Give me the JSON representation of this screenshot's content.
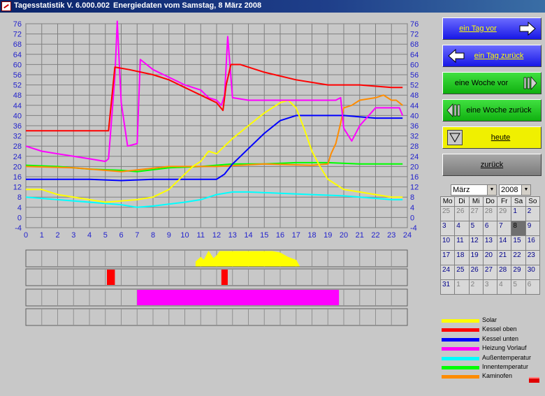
{
  "window": {
    "app_title": "Tagesstatistik V. 6.000.002",
    "date_title": "Energiedaten vom Samstag, 8 März 2008"
  },
  "buttons": {
    "next_day": "ein Tag vor",
    "prev_day": "ein Tag zurück",
    "next_week": "eine Woche vor",
    "prev_week": "eine Woche zurück",
    "today": "heute",
    "back": "zurück"
  },
  "calendar": {
    "month": "März",
    "year": "2008",
    "weekdays": [
      "Mo",
      "Di",
      "Mi",
      "Do",
      "Fr",
      "Sa",
      "So"
    ],
    "weeks": [
      [
        "25",
        "26",
        "27",
        "28",
        "29",
        "1",
        "2"
      ],
      [
        "3",
        "4",
        "5",
        "6",
        "7",
        "8",
        "9"
      ],
      [
        "10",
        "11",
        "12",
        "13",
        "14",
        "15",
        "16"
      ],
      [
        "17",
        "18",
        "19",
        "20",
        "21",
        "22",
        "23"
      ],
      [
        "24",
        "25",
        "26",
        "27",
        "28",
        "29",
        "30"
      ],
      [
        "31",
        "1",
        "2",
        "3",
        "4",
        "5",
        "6"
      ]
    ],
    "selected": "8"
  },
  "legend": [
    {
      "name": "Solar",
      "color": "#ffff00"
    },
    {
      "name": "Kessel oben",
      "color": "#ff0000"
    },
    {
      "name": "Kessel unten",
      "color": "#0000ff"
    },
    {
      "name": "Heizung Vorlauf",
      "color": "#ff00ff"
    },
    {
      "name": "Außentemperatur",
      "color": "#00ffff"
    },
    {
      "name": "Innentemperatur",
      "color": "#00ff00"
    },
    {
      "name": "Kaminofen",
      "color": "#ff8c00"
    }
  ],
  "chart_data": [
    {
      "type": "line",
      "x_ticks": [
        0,
        1,
        2,
        3,
        4,
        5,
        6,
        7,
        8,
        9,
        10,
        11,
        12,
        13,
        14,
        15,
        16,
        17,
        18,
        19,
        20,
        21,
        22,
        23,
        24
      ],
      "y_ticks": [
        -4,
        0,
        4,
        8,
        12,
        16,
        20,
        24,
        28,
        32,
        36,
        40,
        44,
        48,
        52,
        56,
        60,
        64,
        68,
        72,
        76
      ],
      "xlim": [
        0,
        24
      ],
      "ylim": [
        -4,
        76
      ],
      "grid": true,
      "series": [
        {
          "name": "Kessel oben",
          "color": "#ff0000",
          "x": [
            0,
            5.2,
            5.25,
            5.6,
            6.5,
            8,
            9,
            10,
            11,
            12,
            12.4,
            12.6,
            12.9,
            13.5,
            15,
            17,
            19,
            21,
            23,
            23.7
          ],
          "y": [
            34,
            34,
            37,
            59,
            58,
            56,
            54,
            51,
            48,
            45,
            42,
            52,
            60,
            60,
            57,
            54,
            52,
            52,
            51,
            51
          ]
        },
        {
          "name": "Kessel unten",
          "color": "#0000ff",
          "x": [
            0,
            2,
            4,
            6,
            8,
            10,
            11,
            12,
            12.5,
            13,
            14,
            15,
            16,
            17,
            18,
            20,
            22,
            23.7
          ],
          "y": [
            15,
            15,
            15,
            14.5,
            15,
            15,
            15,
            15,
            17,
            21,
            27,
            33,
            38,
            40,
            40,
            40,
            39,
            39
          ]
        },
        {
          "name": "Solar",
          "color": "#ffff00",
          "x": [
            0,
            1,
            2,
            3,
            4,
            5,
            6,
            7,
            8,
            9,
            10,
            10.5,
            11,
            11.5,
            12,
            12.5,
            13,
            14,
            15,
            16,
            16.5,
            17,
            17.5,
            18,
            18.5,
            19,
            19.5,
            20,
            21,
            22,
            23,
            23.7
          ],
          "y": [
            11,
            11,
            9,
            8,
            7,
            6,
            6.5,
            7,
            8,
            11,
            17,
            20,
            22,
            26,
            25,
            28,
            31,
            36,
            41,
            45,
            46,
            43,
            35,
            26,
            20,
            15,
            13,
            11,
            10,
            9,
            8,
            8
          ]
        },
        {
          "name": "Heizung Vorlauf",
          "color": "#ff00ff",
          "x": [
            0,
            1,
            2,
            3,
            4,
            5,
            5.2,
            5.6,
            5.75,
            6,
            6.4,
            7,
            7.2,
            8,
            9,
            10,
            11,
            11.5,
            12,
            12.3,
            12.5,
            12.7,
            13,
            14,
            15,
            16,
            16.5,
            17,
            18,
            19,
            19.5,
            19.8,
            20,
            20.5,
            21,
            22,
            23,
            23.5,
            23.7
          ],
          "y": [
            28,
            26,
            25,
            24,
            23,
            22,
            23,
            55,
            77,
            45,
            28,
            29,
            62,
            58,
            55,
            52,
            50,
            47,
            46,
            44,
            48,
            71,
            47,
            46,
            46,
            46,
            46,
            46,
            46,
            46,
            46,
            47,
            35,
            30,
            36,
            43,
            43,
            43,
            40
          ]
        },
        {
          "name": "Außentemperatur",
          "color": "#00ffff",
          "x": [
            0,
            2,
            4,
            6,
            7,
            8,
            10,
            11,
            12,
            13,
            14,
            16,
            18,
            20,
            21,
            22,
            23,
            23.7
          ],
          "y": [
            8,
            7,
            6,
            5,
            4,
            4.5,
            6,
            7,
            9,
            10,
            10,
            9.5,
            9,
            8.5,
            8,
            7.5,
            7,
            7
          ]
        },
        {
          "name": "Innentemperatur",
          "color": "#00ff00",
          "x": [
            0,
            2,
            4,
            6,
            7,
            9,
            11,
            13,
            15,
            17,
            19,
            21,
            23,
            23.7
          ],
          "y": [
            20.5,
            20,
            19,
            18.5,
            18,
            19.5,
            20,
            21,
            21,
            21.5,
            21.5,
            21,
            21,
            21
          ]
        },
        {
          "name": "Kaminofen",
          "color": "#ff8c00",
          "x": [
            0,
            3,
            6,
            9,
            12,
            15,
            18,
            19,
            19.2,
            19.5,
            19.8,
            20,
            20.5,
            21,
            22,
            22.5,
            23,
            23.3,
            23.7
          ],
          "y": [
            20,
            19.5,
            18,
            20,
            20,
            21,
            20.5,
            21,
            25,
            29,
            37,
            43,
            44,
            46,
            47,
            48,
            46,
            46,
            44
          ]
        }
      ]
    },
    {
      "type": "timeline",
      "xlim": [
        0,
        24
      ],
      "rows": [
        {
          "name": "Solar",
          "color": "#ffff00",
          "x": [
            10.7,
            11,
            11.2,
            11.5,
            11.8,
            12,
            12.2,
            12.5,
            13,
            13.5,
            14,
            14.5,
            15,
            15.5,
            16,
            16.5,
            17,
            17.2
          ],
          "values": [
            0.3,
            0.6,
            0.4,
            1,
            0.5,
            0.7,
            1,
            1,
            1,
            1,
            1,
            1,
            1,
            1,
            0.9,
            0.6,
            0.4,
            0
          ]
        },
        {
          "name": "Kessel oben",
          "color": "#ff0000",
          "intervals": [
            [
              5.1,
              5.6
            ],
            [
              12.3,
              12.7
            ]
          ]
        },
        {
          "name": "Heizung Vorlauf",
          "color": "#ff00ff",
          "intervals": [
            [
              7,
              19.7
            ]
          ]
        },
        {
          "name": "Kaminofen",
          "color": "#ff8c00",
          "intervals": []
        }
      ]
    }
  ]
}
